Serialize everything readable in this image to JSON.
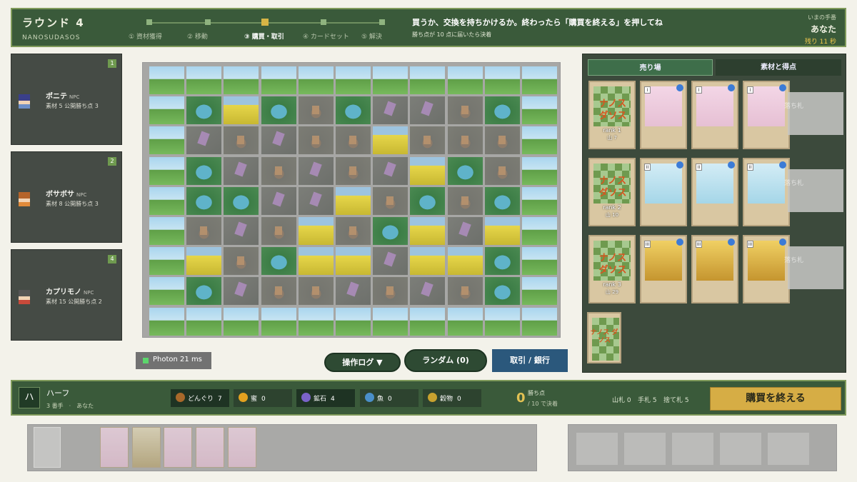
{
  "header": {
    "round": "ラウンド 4",
    "game_name": "NANOSUDASOS",
    "phases": [
      "① 資材獲得",
      "② 移動",
      "③ 購買・取引",
      "④ カードセット",
      "⑤ 解決"
    ],
    "current_phase_index": 2,
    "instruction": "買うか、交換を持ちかけるか。終わったら「購買を終える」を押してね",
    "sub_instruction": "勝ち点が 10 点に届いたら決着",
    "turn_label": "いまの手番",
    "turn_player": "あなた",
    "time_left": "残り 11 秒"
  },
  "players": [
    {
      "num": "1",
      "name": "ポニテ",
      "tag": "NPC",
      "stats": "素材 5  公開勝ち点 3"
    },
    {
      "num": "2",
      "name": "ボサボサ",
      "tag": "NPC",
      "stats": "素材 8  公開勝ち点 3"
    },
    {
      "num": "4",
      "name": "カプリモノ",
      "tag": "NPC",
      "stats": "素材 15  公開勝ち点 2"
    }
  ],
  "board": {
    "rows": [
      [
        "grass",
        "grass",
        "grass",
        "grass",
        "grass",
        "grass",
        "grass",
        "grass",
        "grass",
        "grass",
        "grass"
      ],
      [
        "grass",
        "pond",
        "field",
        "pond",
        "tree",
        "pond",
        "crystal",
        "crystal",
        "tree",
        "pond",
        "grass"
      ],
      [
        "grass",
        "crystal",
        "tree",
        "crystal",
        "tree",
        "tree",
        "field",
        "tree",
        "tree",
        "tree",
        "grass"
      ],
      [
        "grass",
        "pond",
        "crystal",
        "tree",
        "crystal",
        "tree",
        "crystal",
        "field",
        "pond",
        "tree",
        "grass"
      ],
      [
        "grass",
        "pond",
        "pond",
        "crystal",
        "crystal",
        "field",
        "tree",
        "pond",
        "tree",
        "pond",
        "grass"
      ],
      [
        "grass",
        "tree",
        "crystal",
        "tree",
        "field",
        "tree",
        "pond",
        "field",
        "crystal",
        "field",
        "grass"
      ],
      [
        "grass",
        "field",
        "tree",
        "pond",
        "field",
        "field",
        "crystal",
        "field",
        "field",
        "pond",
        "grass"
      ],
      [
        "grass",
        "pond",
        "crystal",
        "tree",
        "tree",
        "crystal",
        "tree",
        "crystal",
        "tree",
        "pond",
        "grass"
      ],
      [
        "grass",
        "grass",
        "grass",
        "grass",
        "grass",
        "grass",
        "grass",
        "grass",
        "grass",
        "grass",
        "grass"
      ]
    ]
  },
  "controls": {
    "photon": "Photon  21 ms",
    "log_button": "操作ログ ▼",
    "random_button": "ランダム (0)",
    "trade_button": "取引 / 銀行"
  },
  "market": {
    "tabs": [
      "売り場",
      "素材と得点"
    ],
    "rows": [
      {
        "deck_logo": "ナノス\nダソス",
        "rank": "rank 1",
        "remaining": "山 7",
        "cards": [
          "pink",
          "pink",
          "pink"
        ]
      },
      {
        "deck_logo": "ナノス\nダソス",
        "rank": "rank 2",
        "remaining": "山 10",
        "cards": [
          "blue",
          "blue",
          "blue"
        ]
      },
      {
        "deck_logo": "ナノス\nダソス",
        "rank": "rank 3",
        "remaining": "山 29",
        "cards": [
          "gold",
          "gold",
          "gold"
        ]
      }
    ],
    "ghost_label": "落ち札",
    "small_logo": "ナノス\nダソス"
  },
  "me": {
    "badge": "ハ",
    "name": "ハーフ",
    "seat": "3 番手　·　あなた",
    "resources": [
      {
        "icon": "acorn-icon",
        "label": "どんぐり",
        "value": "7",
        "color": "#a8682a"
      },
      {
        "icon": "honey-icon",
        "label": "蜜",
        "value": "0",
        "color": "#e3a11f"
      },
      {
        "icon": "ore-icon",
        "label": "鉱石",
        "value": "4",
        "color": "#7a63c9"
      },
      {
        "icon": "fish-icon",
        "label": "魚",
        "value": "0",
        "color": "#4a8fc9"
      },
      {
        "icon": "grain-icon",
        "label": "穀物",
        "value": "0",
        "color": "#c8a22f"
      }
    ],
    "vp": "0",
    "vp_label": "勝ち点",
    "vp_goal": "/ 10 で決着",
    "deck": "山札 0",
    "hand": "手札 5",
    "discard": "捨て札 5",
    "end_button": "購買を終える"
  },
  "hand_cards": [
    "pink",
    "cgrass",
    "pink",
    "pink",
    "pink"
  ]
}
